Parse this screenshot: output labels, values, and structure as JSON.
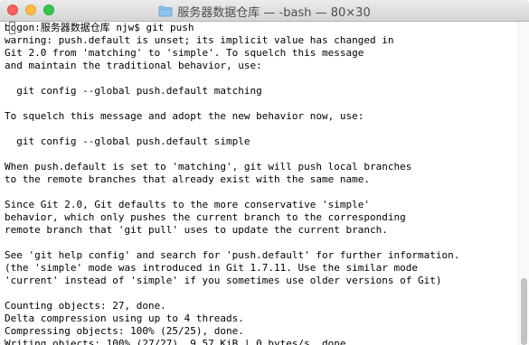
{
  "window": {
    "title": "服务器数据仓库 — -bash — 80×30"
  },
  "terminal": {
    "lines": [
      "bogon:服务器数据仓库 njw$ git push",
      "warning: push.default is unset; its implicit value has changed in",
      "Git 2.0 from 'matching' to 'simple'. To squelch this message",
      "and maintain the traditional behavior, use:",
      "",
      "  git config --global push.default matching",
      "",
      "To squelch this message and adopt the new behavior now, use:",
      "",
      "  git config --global push.default simple",
      "",
      "When push.default is set to 'matching', git will push local branches",
      "to the remote branches that already exist with the same name.",
      "",
      "Since Git 2.0, Git defaults to the more conservative 'simple'",
      "behavior, which only pushes the current branch to the corresponding",
      "remote branch that 'git pull' uses to update the current branch.",
      "",
      "See 'git help config' and search for 'push.default' for further information.",
      "(the 'simple' mode was introduced in Git 1.7.11. Use the similar mode",
      "'current' instead of 'simple' if you sometimes use older versions of Git)",
      "",
      "Counting objects: 27, done.",
      "Delta compression using up to 4 threads.",
      "Compressing objects: 100% (25/25), done.",
      "Writing objects: 100% (27/27), 9.57 KiB | 0 bytes/s, done."
    ]
  },
  "colors": {
    "close": "#fc605c",
    "minimize": "#fdbc40",
    "maximize": "#34c84a",
    "folder": "#8fc3ea"
  },
  "icons": {
    "title": "folder-icon"
  }
}
